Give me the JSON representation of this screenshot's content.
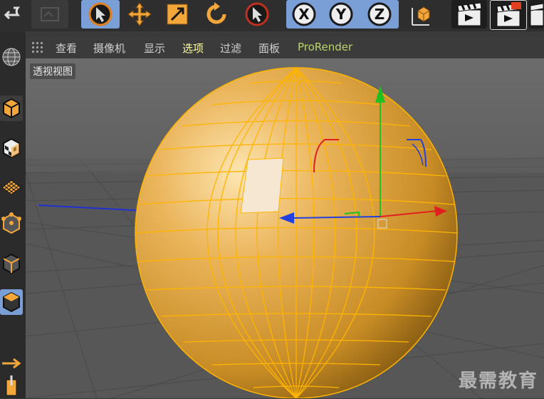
{
  "menu": {
    "items": [
      "查看",
      "摄像机",
      "显示",
      "选项",
      "过滤",
      "面板",
      "ProRender"
    ],
    "highlighted": "选项"
  },
  "viewport": {
    "label": "透视视图"
  },
  "watermark": "最需教育",
  "toolbar": {
    "axis_x": "X",
    "axis_y": "Y",
    "axis_z": "Z"
  },
  "colors": {
    "sphere": "#e8a93a",
    "wire": "#ffb400",
    "toolbar_bg": "#2e2e2e",
    "button_blue": "#7a9ed6",
    "axis_x": "#e02020",
    "axis_y": "#20c020",
    "axis_z": "#2040e0"
  }
}
